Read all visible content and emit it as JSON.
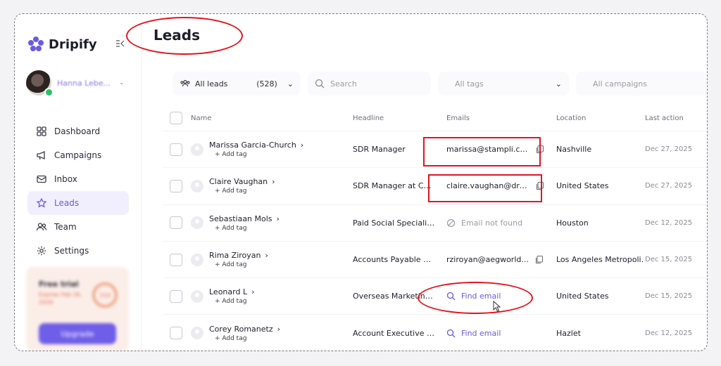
{
  "brand": {
    "name": "Dripify"
  },
  "user": {
    "name": "Hanna Lebe..."
  },
  "nav": [
    {
      "label": "Dashboard",
      "icon": "grid-icon"
    },
    {
      "label": "Campaigns",
      "icon": "megaphone-icon"
    },
    {
      "label": "Inbox",
      "icon": "mail-icon"
    },
    {
      "label": "Leads",
      "icon": "star-icon",
      "active": true
    },
    {
      "label": "Team",
      "icon": "users-icon"
    },
    {
      "label": "Settings",
      "icon": "gear-icon"
    }
  ],
  "trial": {
    "title": "Free trial",
    "subtitle": "Expires Feb 26, 2026",
    "ring": "21d",
    "upgrade_label": "Upgrade"
  },
  "page": {
    "title": "Leads"
  },
  "filters": {
    "all_leads_label": "All leads",
    "all_leads_count": "(528)",
    "search_placeholder": "Search",
    "tags_label": "All tags",
    "campaigns_label": "All campaigns"
  },
  "table": {
    "headers": {
      "name": "Name",
      "headline": "Headline",
      "emails": "Emails",
      "location": "Location",
      "last_action": "Last action"
    },
    "add_tag_label": "+ Add tag",
    "rows": [
      {
        "name": "Marissa Garcia-Church",
        "headline": "SDR Manager",
        "email": "marissa@stampli.com",
        "email_state": "found",
        "location": "Nashville",
        "last_action": "Dec 27, 2025"
      },
      {
        "name": "Claire Vaughan",
        "headline": "SDR Manager at Cyberh...",
        "email": "claire.vaughan@dre...",
        "email_state": "found",
        "location": "United States",
        "last_action": "Dec 27, 2025"
      },
      {
        "name": "Sebastiaan Mols",
        "headline": "Paid Social Specialist dri...",
        "email": "Email not found",
        "email_state": "notfound",
        "location": "Houston",
        "last_action": "Dec 12, 2025"
      },
      {
        "name": "Rima Ziroyan",
        "headline": "Accounts Payable Speci...",
        "email": "rziroyan@aegworld...",
        "email_state": "found",
        "location": "Los Angeles Metropoli...",
        "last_action": "Dec 15, 2025"
      },
      {
        "name": "Leonard L",
        "headline": "Overseas Marketing Ma...",
        "email": "Find email",
        "email_state": "find",
        "location": "United States",
        "last_action": "Dec 15, 2025"
      },
      {
        "name": "Corey Romanetz",
        "headline": "Account Executive at Shi...",
        "email": "Find email",
        "email_state": "find",
        "location": "Hazlet",
        "last_action": "Dec 12, 2025"
      }
    ]
  },
  "colors": {
    "accent": "#6a5ae0",
    "annotation": "#e3141b"
  }
}
